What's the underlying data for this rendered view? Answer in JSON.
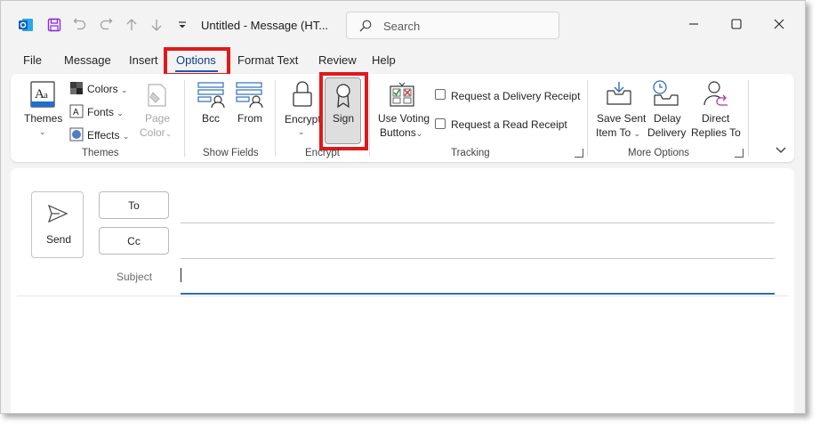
{
  "window": {
    "title": "Untitled  -  Message (HT...",
    "search_placeholder": "Search",
    "quick_access": [
      "outlook-logo-icon",
      "save-icon",
      "undo-icon",
      "redo-icon",
      "up-arrow-icon",
      "down-arrow-icon",
      "customize-icon"
    ]
  },
  "tabs": [
    "File",
    "Message",
    "Insert",
    "Options",
    "Format Text",
    "Review",
    "Help"
  ],
  "active_tab": "Options",
  "ribbon": {
    "themes": {
      "themes_label": "Themes",
      "colors_label": "Colors",
      "fonts_label": "Fonts",
      "effects_label": "Effects",
      "page_color_line1": "Page",
      "page_color_line2": "Color",
      "group": "Themes"
    },
    "show_fields": {
      "bcc_label": "Bcc",
      "from_label": "From",
      "group": "Show Fields"
    },
    "encrypt": {
      "encrypt_label": "Encrypt",
      "sign_label": "Sign",
      "group": "Encrypt"
    },
    "tracking": {
      "voting_line1": "Use Voting",
      "voting_line2": "Buttons",
      "delivery_receipt": "Request a Delivery Receipt",
      "read_receipt": "Request a Read Receipt",
      "group": "Tracking"
    },
    "more_options": {
      "save_sent_line1": "Save Sent",
      "save_sent_line2": "Item To",
      "delay_line1": "Delay",
      "delay_line2": "Delivery",
      "replies_line1": "Direct",
      "replies_line2": "Replies To",
      "group": "More Options"
    }
  },
  "compose": {
    "send_label": "Send",
    "to_label": "To",
    "cc_label": "Cc",
    "subject_label": "Subject",
    "to_value": "",
    "cc_value": "",
    "subject_value": ""
  },
  "colors": {
    "highlight": "#e0191b",
    "accent": "#0f5fbf"
  }
}
